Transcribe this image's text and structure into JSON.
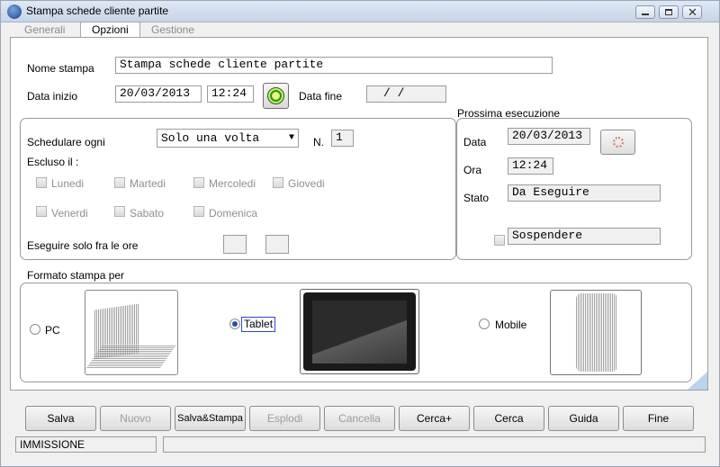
{
  "window": {
    "title": "Stampa schede cliente partite"
  },
  "tabs": [
    "Generali",
    "Opzioni",
    "Gestione |"
  ],
  "form": {
    "nome_stampa_label": "Nome stampa",
    "nome_stampa_value": "Stampa schede cliente partite",
    "data_inizio_label": "Data inizio",
    "data_inizio_value": "20/03/2013",
    "ora_inizio_value": "12:24",
    "data_fine_label": "Data fine",
    "data_fine_value": "/ /"
  },
  "schedule": {
    "schedulare_label": "Schedulare ogni",
    "schedulare_value": "Solo una volta",
    "n_label": "N.",
    "n_value": "1",
    "escluso_label": "Escluso il :",
    "days": [
      "Lunedi",
      "Martedi",
      "Mercoledi",
      "Giovedi",
      "Venerdi",
      "Sabato",
      "Domenica"
    ],
    "eseguire_label": "Eseguire solo fra le ore"
  },
  "prossima": {
    "title": "Prossima esecuzione",
    "data_label": "Data",
    "data_value": "20/03/2013",
    "ora_label": "Ora",
    "ora_value": "12:24",
    "stato_label": "Stato",
    "stato_value": "Da Eseguire",
    "sospendere_label": "Sospendere"
  },
  "formato": {
    "title": "Formato stampa per",
    "options": [
      "PC",
      "Tablet",
      "Mobile"
    ],
    "selected": "Tablet"
  },
  "buttons": [
    "Salva",
    "Nuovo",
    "Salva&Stampa",
    "Esplodi",
    "Cancella",
    "Cerca+",
    "Cerca",
    "Guida",
    "Fine"
  ],
  "status": {
    "mode": "IMMISSIONE",
    "message": ""
  }
}
